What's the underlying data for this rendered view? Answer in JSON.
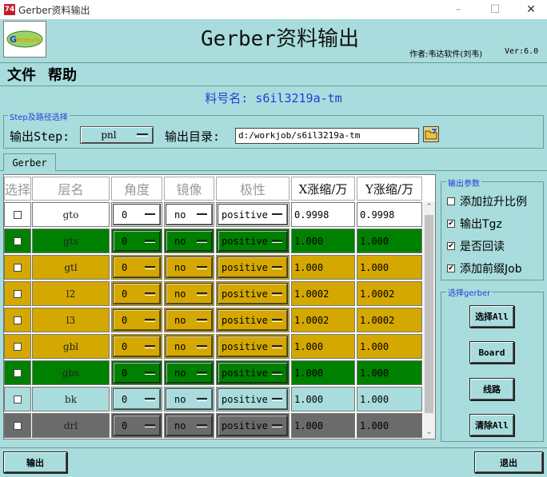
{
  "window": {
    "title": "Gerber资料输出",
    "app_icon": "74"
  },
  "header": {
    "title": "Gerber资料输出",
    "author": "作者:韦达软件(刘韦)",
    "version": "Ver:6.0"
  },
  "menu": [
    "文件",
    "帮助"
  ],
  "part_number": "料号名: s6il3219a-tm",
  "step_group": {
    "legend": "Step及路径选择",
    "step_label": "输出Step:",
    "step_value": "pnl",
    "dir_label": "输出目录:",
    "dir_value": "d:/workjob/s6il3219a-tm"
  },
  "tabs": [
    "Gerber"
  ],
  "table": {
    "headers": [
      "选择",
      "层名",
      "角度",
      "镜像",
      "极性",
      "X涨缩/万",
      "Y涨缩/万"
    ],
    "rows": [
      {
        "layer": "gto",
        "angle": "0",
        "mirror": "no",
        "polarity": "positive",
        "x": "0.9998",
        "y": "0.9998",
        "color": "#ffffff"
      },
      {
        "layer": "gts",
        "angle": "0",
        "mirror": "no",
        "polarity": "positive",
        "x": "1.000",
        "y": "1.000",
        "color": "#008000"
      },
      {
        "layer": "gtl",
        "angle": "0",
        "mirror": "no",
        "polarity": "positive",
        "x": "1.000",
        "y": "1.000",
        "color": "#d4a800"
      },
      {
        "layer": "l2",
        "angle": "0",
        "mirror": "no",
        "polarity": "positive",
        "x": "1.0002",
        "y": "1.0002",
        "color": "#d4a800"
      },
      {
        "layer": "l3",
        "angle": "0",
        "mirror": "no",
        "polarity": "positive",
        "x": "1.0002",
        "y": "1.0002",
        "color": "#d4a800"
      },
      {
        "layer": "gbl",
        "angle": "0",
        "mirror": "no",
        "polarity": "positive",
        "x": "1.000",
        "y": "1.000",
        "color": "#d4a800"
      },
      {
        "layer": "gbs",
        "angle": "0",
        "mirror": "no",
        "polarity": "positive",
        "x": "1.000",
        "y": "1.000",
        "color": "#008000"
      },
      {
        "layer": "bk",
        "angle": "0",
        "mirror": "no",
        "polarity": "positive",
        "x": "1.000",
        "y": "1.000",
        "color": "#a9dcdc"
      },
      {
        "layer": "drl",
        "angle": "0",
        "mirror": "no",
        "polarity": "positive",
        "x": "1.000",
        "y": "1.000",
        "color": "#6b6b6b"
      }
    ]
  },
  "output_params": {
    "legend": "输出参数",
    "options": [
      {
        "label": "添加拉升比例",
        "checked": false
      },
      {
        "label": "输出Tgz",
        "checked": true
      },
      {
        "label": "是否回读",
        "checked": true
      },
      {
        "label": "添加前缀Job",
        "checked": true
      }
    ]
  },
  "select_gerber": {
    "legend": "选择gerber",
    "buttons": [
      "选择All",
      "Board",
      "线路",
      "清除All"
    ]
  },
  "footer": {
    "output_button": "输出",
    "exit_button": "退出"
  },
  "colors": {
    "background": "#a9dcdc",
    "accent_blue": "#1b3fd8"
  },
  "icons": {
    "logo": "genesis-logo",
    "folder": "folder-icon"
  }
}
